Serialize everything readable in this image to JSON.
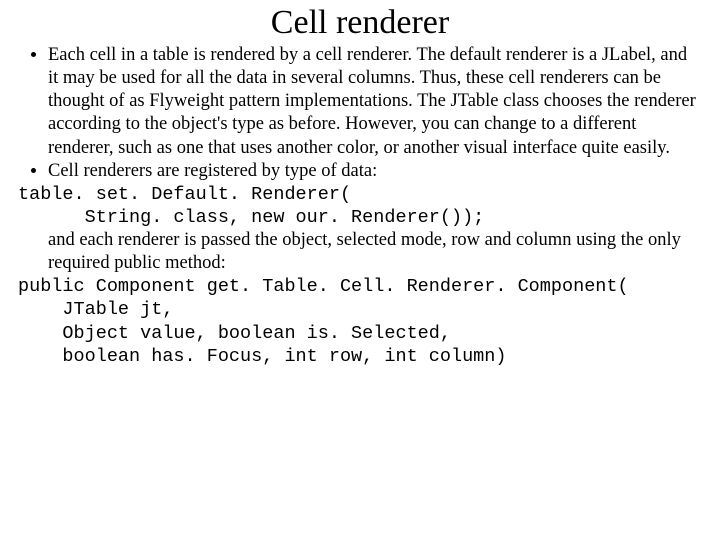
{
  "title": "Cell renderer",
  "bullets": [
    "Each cell in a table is rendered by a cell renderer. The default renderer is a JLabel, and it may be used for all the data in several columns. Thus, these cell renderers can be thought of as Flyweight pattern implementations. The JTable class chooses the renderer according to the object's type as before. However, you can change to a different renderer, such as one that uses another color, or another visual interface quite easily.",
    "Cell renderers are registered by type of data:"
  ],
  "code1": "table. set. Default. Renderer(\n      String. class, new our. Renderer());",
  "mid_text": "and each renderer is passed the object, selected mode, row and column using the only required public method:",
  "code2": "public Component get. Table. Cell. Renderer. Component(\n    JTable jt,\n    Object value, boolean is. Selected,\n    boolean has. Focus, int row, int column)"
}
